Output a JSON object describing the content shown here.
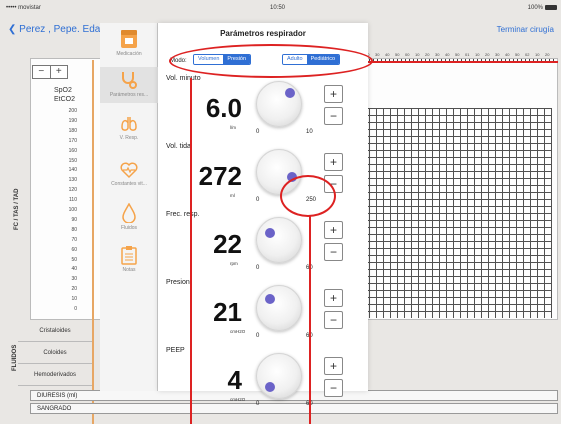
{
  "status": {
    "carrier": "••••• movistar",
    "time": "10:50",
    "battery": "100%"
  },
  "nav": {
    "back_label": "Perez , Pepe. Eda",
    "finish_label": "Terminar cirugía"
  },
  "vitals": {
    "spo2": "SpO2",
    "etco2": "EtCO2",
    "axis_title": "FC / TAS / TAD",
    "y_ticks": [
      "200",
      "190",
      "180",
      "170",
      "160",
      "150",
      "140",
      "130",
      "120",
      "110",
      "100",
      "90",
      "80",
      "70",
      "60",
      "50",
      "40",
      "30",
      "20",
      "10",
      "0"
    ]
  },
  "timeruler": {
    "labels": [
      "10",
      "30",
      "40",
      "50",
      "00",
      "10",
      "20",
      "30",
      "40",
      "50",
      "01",
      "10",
      "20",
      "30",
      "40",
      "50",
      "02",
      "10",
      "20"
    ]
  },
  "zoom": {
    "minus": "−",
    "plus": "+"
  },
  "fluids": {
    "side_title": "FLUIDOS",
    "rows": [
      "Cristaloides",
      "Coloides",
      "Hemoderivados"
    ],
    "diuresis": "DIURESIS (ml)",
    "sangrado": "SANGRADO"
  },
  "menu": {
    "items": [
      "Medicación",
      "Parámetros res...",
      "V. Resp.",
      "Constantes vit...",
      "Fluidos",
      "Notas"
    ]
  },
  "panel": {
    "title": "Parámetros respirador",
    "mode_label": "Modo:",
    "mode_options": [
      "Volumen",
      "Presión"
    ],
    "patient_options": [
      "Adulto",
      "Pediátrico"
    ],
    "params": [
      {
        "name": "Vol. minuto",
        "value": "6.0",
        "unit": "l/m",
        "min": "0",
        "max": "10"
      },
      {
        "name": "Vol. tidal",
        "value": "272",
        "unit": "ml",
        "min": "0",
        "max": "250"
      },
      {
        "name": "Frec. resp.",
        "value": "22",
        "unit": "rpm",
        "min": "0",
        "max": "60"
      },
      {
        "name": "Presion",
        "value": "21",
        "unit": "cmH2O",
        "min": "0",
        "max": "60"
      },
      {
        "name": "PEEP",
        "value": "4",
        "unit": "cmH2O",
        "min": "0",
        "max": "60"
      }
    ],
    "plus": "+",
    "minus": "−"
  },
  "colors": {
    "accent": "#2f6fd4",
    "annotation": "#dd2222",
    "knob_dot": "#6b63c8",
    "orange": "#e7a765"
  }
}
